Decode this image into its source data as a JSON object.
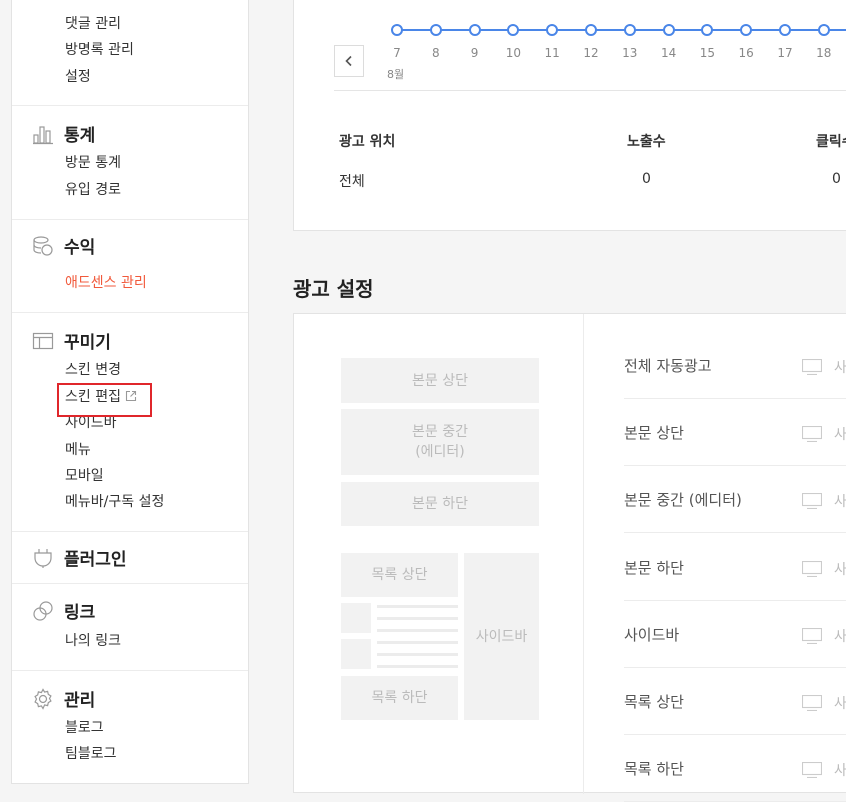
{
  "sidebar": {
    "sections": [
      {
        "title": "",
        "items": [
          "댓글 관리",
          "방명록 관리",
          "설정"
        ]
      },
      {
        "title": "통계",
        "icon": "chart-icon",
        "items": [
          "방문 통계",
          "유입 경로"
        ]
      },
      {
        "title": "수익",
        "icon": "coins-icon",
        "items": [
          "애드센스 관리"
        ]
      },
      {
        "title": "꾸미기",
        "icon": "layout-icon",
        "items": [
          "스킨 변경",
          "스킨 편집",
          "사이드바",
          "메뉴",
          "모바일",
          "메뉴바/구독 설정"
        ]
      },
      {
        "title": "플러그인",
        "icon": "plug-icon",
        "items": []
      },
      {
        "title": "링크",
        "icon": "link-icon",
        "items": [
          "나의 링크"
        ]
      },
      {
        "title": "관리",
        "icon": "gear-icon",
        "items": [
          "블로그",
          "팀블로그"
        ]
      }
    ]
  },
  "timeline": {
    "days": [
      "7",
      "8",
      "9",
      "10",
      "11",
      "12",
      "13",
      "14",
      "15",
      "16",
      "17",
      "18"
    ],
    "month": "8월"
  },
  "stats_table": {
    "headers": [
      "광고 위치",
      "노출수",
      "클릭수"
    ],
    "row": [
      "전체",
      "0",
      "0"
    ]
  },
  "ad_settings": {
    "title": "광고 설정",
    "preview": {
      "body_top": "본문 상단",
      "body_middle_1": "본문 중간",
      "body_middle_2": "(에디터)",
      "body_bottom": "본문 하단",
      "list_top": "목록 상단",
      "list_bottom": "목록 하단",
      "sidebar": "사이드바"
    },
    "rows": [
      {
        "label": "전체 자동광고",
        "ctl": "사"
      },
      {
        "label": "본문 상단",
        "ctl": "사"
      },
      {
        "label": "본문 중간 (에디터)",
        "ctl": "사"
      },
      {
        "label": "본문 하단",
        "ctl": "사"
      },
      {
        "label": "사이드바",
        "ctl": "사"
      },
      {
        "label": "목록 상단",
        "ctl": "사"
      },
      {
        "label": "목록 하단",
        "ctl": "사"
      }
    ]
  },
  "colors": {
    "accent_red": "#f15a3c",
    "timeline_blue": "#4a86e8",
    "highlight": "#e0262b"
  }
}
